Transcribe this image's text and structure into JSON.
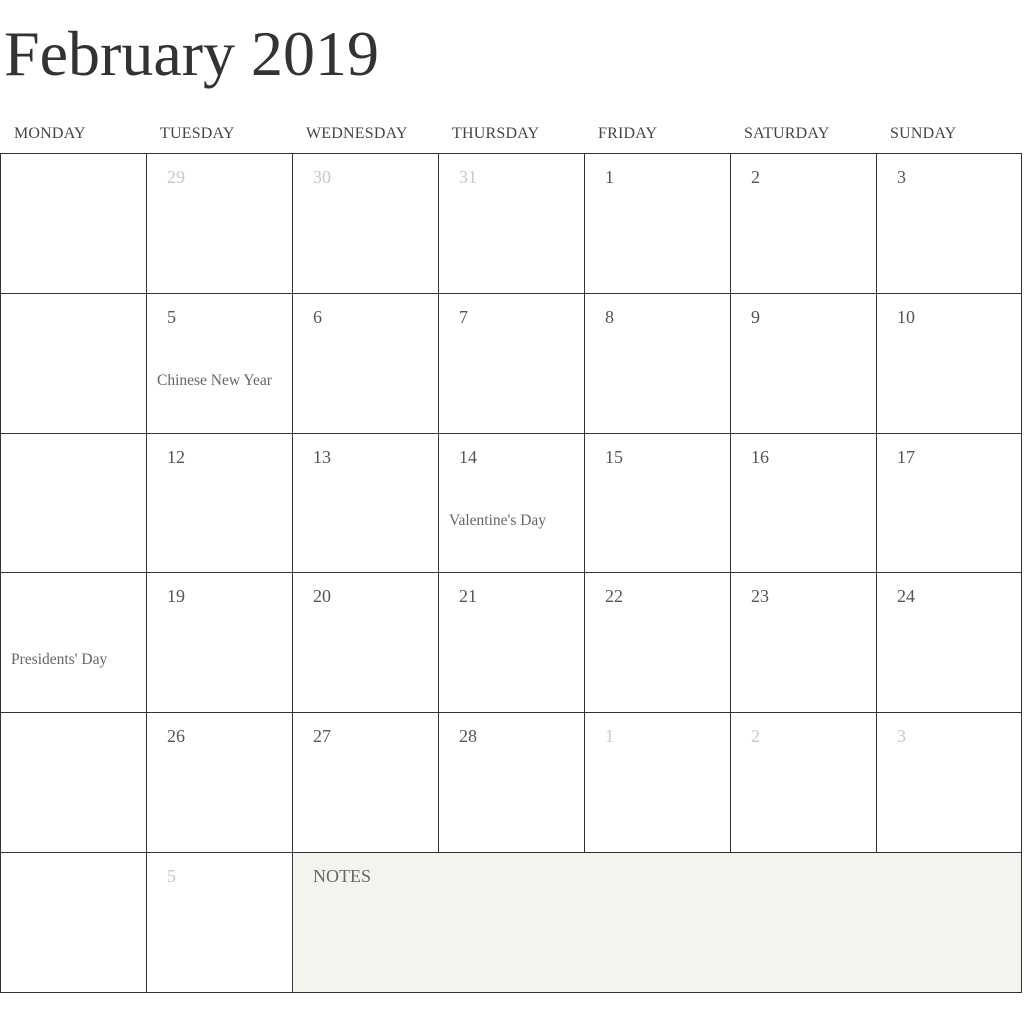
{
  "title": "February 2019",
  "weekdays": [
    "MONDAY",
    "TUESDAY",
    "WEDNESDAY",
    "THURSDAY",
    "FRIDAY",
    "SATURDAY",
    "SUNDAY"
  ],
  "weeks": [
    [
      {
        "day": "",
        "other": true
      },
      {
        "day": "29",
        "other": true
      },
      {
        "day": "30",
        "other": true
      },
      {
        "day": "31",
        "other": true
      },
      {
        "day": "1"
      },
      {
        "day": "2"
      },
      {
        "day": "3"
      }
    ],
    [
      {
        "day": ""
      },
      {
        "day": "5",
        "event": "Chinese New Year"
      },
      {
        "day": "6"
      },
      {
        "day": "7"
      },
      {
        "day": "8"
      },
      {
        "day": "9"
      },
      {
        "day": "10"
      }
    ],
    [
      {
        "day": ""
      },
      {
        "day": "12"
      },
      {
        "day": "13"
      },
      {
        "day": "14",
        "event": "Valentine's Day"
      },
      {
        "day": "15"
      },
      {
        "day": "16"
      },
      {
        "day": "17"
      }
    ],
    [
      {
        "day": "",
        "event": "Presidents' Day"
      },
      {
        "day": "19"
      },
      {
        "day": "20"
      },
      {
        "day": "21"
      },
      {
        "day": "22"
      },
      {
        "day": "23"
      },
      {
        "day": "24"
      }
    ],
    [
      {
        "day": ""
      },
      {
        "day": "26"
      },
      {
        "day": "27"
      },
      {
        "day": "28"
      },
      {
        "day": "1",
        "other": true
      },
      {
        "day": "2",
        "other": true
      },
      {
        "day": "3",
        "other": true
      }
    ],
    [
      {
        "day": "",
        "other": true
      },
      {
        "day": "5",
        "other": true
      }
    ]
  ],
  "notes_label": "NOTES",
  "colors": {
    "grid": "#333333",
    "notes_bg": "#f4f4ef",
    "other_month": "#c8c8c8"
  }
}
